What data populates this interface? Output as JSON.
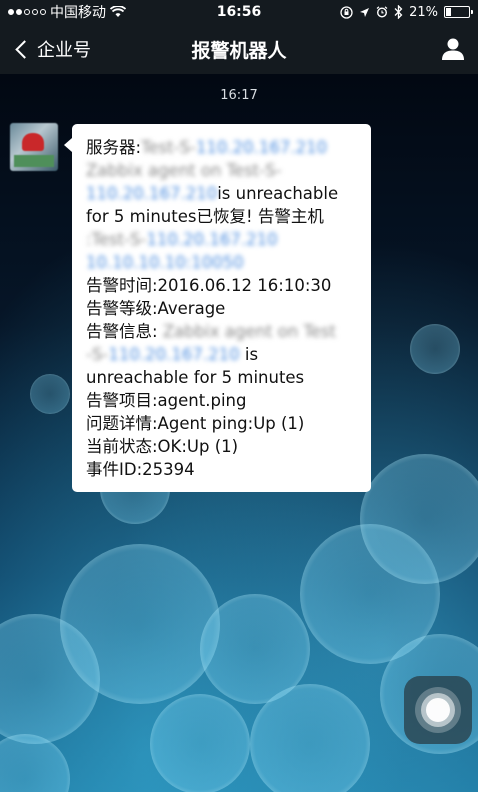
{
  "status_bar": {
    "signal_dots_filled": 2,
    "signal_dots_total": 5,
    "carrier": "中国移动",
    "time": "16:56",
    "battery_percent": "21%",
    "battery_level": 0.21,
    "icons": [
      "wifi-icon",
      "rotation-lock-icon",
      "location-icon",
      "alarm-icon",
      "bluetooth-icon"
    ]
  },
  "nav": {
    "back_label": "企业号",
    "title": "报警机器人",
    "right_icon": "person-icon"
  },
  "chat": {
    "timestamp": "16:17",
    "message": {
      "lines": [
        {
          "parts": [
            {
              "t": "服务器:",
              "s": "plain"
            },
            {
              "t": "Test-S-",
              "s": "blur-gray"
            },
            {
              "t": "110.20.167.210",
              "s": "blur-blue"
            }
          ]
        },
        {
          "parts": [
            {
              "t": "Zabbix agent on Test-S-",
              "s": "blur-gray"
            }
          ]
        },
        {
          "parts": [
            {
              "t": "110.20.167.210",
              "s": "blur-blue"
            },
            {
              "t": "is unreachable",
              "s": "plain"
            }
          ]
        },
        {
          "parts": [
            {
              "t": "for 5 minutes已恢复! 告警主机",
              "s": "plain"
            }
          ]
        },
        {
          "parts": [
            {
              "t": ":Test-S-",
              "s": "blur-gray"
            },
            {
              "t": "110.20.167.210",
              "s": "blur-blue"
            }
          ]
        },
        {
          "parts": [
            {
              "t": "10.10.10.10:10050",
              "s": "blur-blue"
            }
          ]
        },
        {
          "parts": [
            {
              "t": " 告警时间:2016.06.12 16:10:30",
              "s": "plain"
            }
          ]
        },
        {
          "parts": [
            {
              "t": " 告警等级:Average",
              "s": "plain"
            }
          ]
        },
        {
          "parts": [
            {
              "t": " 告警信息: ",
              "s": "plain"
            },
            {
              "t": "Zabbix agent on Test",
              "s": "blur-gray"
            }
          ]
        },
        {
          "parts": [
            {
              "t": "-S-",
              "s": "blur-gray"
            },
            {
              "t": "110.20.167.210",
              "s": "blur-blue"
            },
            {
              "t": " is",
              "s": "plain"
            }
          ]
        },
        {
          "parts": [
            {
              "t": "unreachable for 5 minutes",
              "s": "plain"
            }
          ]
        },
        {
          "parts": [
            {
              "t": " 告警项目:agent.ping",
              "s": "plain"
            }
          ]
        },
        {
          "parts": [
            {
              "t": " 问题详情:Agent ping:Up (1)",
              "s": "plain"
            }
          ]
        },
        {
          "parts": [
            {
              "t": " 当前状态:OK:Up (1)",
              "s": "plain"
            }
          ]
        },
        {
          "parts": [
            {
              "t": " 事件ID:25394",
              "s": "plain"
            }
          ]
        }
      ]
    }
  },
  "assistive_touch": {
    "icon": "assistive-touch-icon"
  },
  "colors": {
    "bar_bg": "#141a1f",
    "bubble_bg": "#ffffff",
    "link_blue": "#4d8ee0"
  }
}
